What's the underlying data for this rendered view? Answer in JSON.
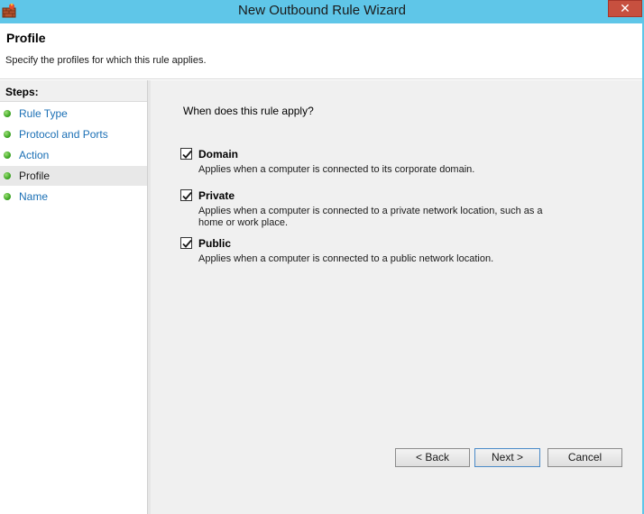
{
  "window": {
    "title": "New Outbound Rule Wizard",
    "close_label": "✕"
  },
  "header": {
    "title": "Profile",
    "description": "Specify the profiles for which this rule applies."
  },
  "steps": {
    "title": "Steps:",
    "items": [
      {
        "label": "Rule Type",
        "active": false
      },
      {
        "label": "Protocol and Ports",
        "active": false
      },
      {
        "label": "Action",
        "active": false
      },
      {
        "label": "Profile",
        "active": true
      },
      {
        "label": "Name",
        "active": false
      }
    ]
  },
  "content": {
    "question": "When does this rule apply?",
    "options": [
      {
        "label": "Domain",
        "checked": true,
        "description": "Applies when a computer is connected to its corporate domain."
      },
      {
        "label": "Private",
        "checked": true,
        "description": "Applies when a computer is connected to a private network location, such as a home or work place."
      },
      {
        "label": "Public",
        "checked": true,
        "description": "Applies when a computer is connected to a public network location."
      }
    ]
  },
  "buttons": {
    "back": "< Back",
    "next": "Next >",
    "cancel": "Cancel"
  },
  "colors": {
    "titlebar": "#5fc6e8",
    "close": "#c7503f",
    "link": "#1a6fb5",
    "content_bg": "#f0f0f0"
  },
  "icons": {
    "app": "firewall-icon",
    "step": "green-dot-icon",
    "check": "checkmark-icon"
  }
}
